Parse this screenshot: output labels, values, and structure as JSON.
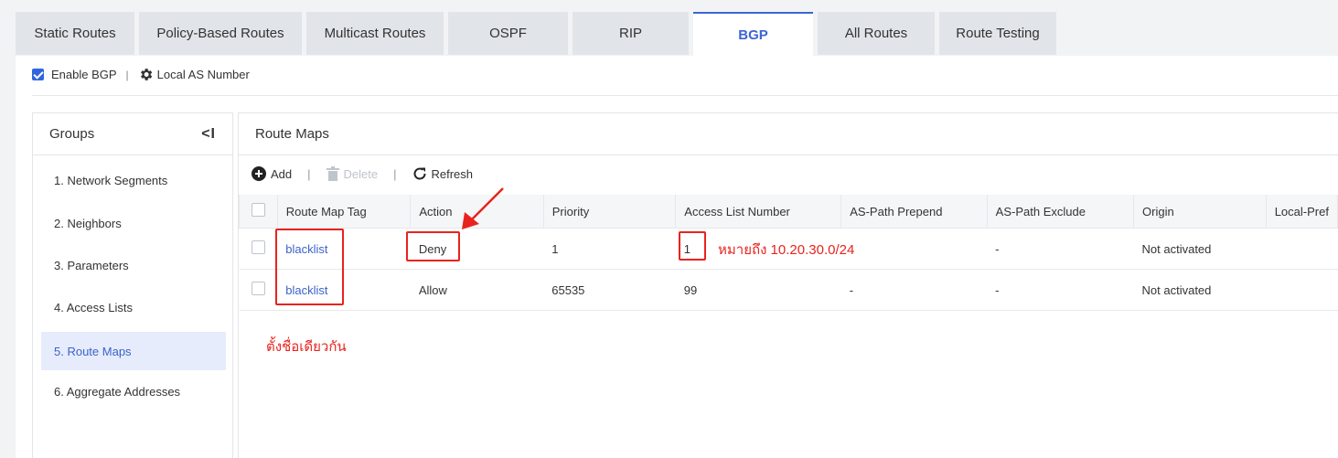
{
  "tabs": [
    "Static Routes",
    "Policy-Based Routes",
    "Multicast Routes",
    "OSPF",
    "RIP",
    "BGP",
    "All Routes",
    "Route Testing"
  ],
  "active_tab": "BGP",
  "toolbar": {
    "enable_label": "Enable BGP",
    "enable_checked": true,
    "as_label": "Local AS Number",
    "separator": "|"
  },
  "groups": {
    "title": "Groups",
    "collapse_icon": "<I",
    "items": [
      "1. Network Segments",
      "2. Neighbors",
      "3. Parameters",
      "4. Access Lists",
      "5. Route Maps",
      "6. Aggregate Addresses"
    ],
    "active_index": 4
  },
  "main": {
    "title": "Route Maps",
    "actions": {
      "add": "Add",
      "delete": "Delete",
      "refresh": "Refresh",
      "separator": "|"
    },
    "columns": [
      "Route Map Tag",
      "Action",
      "Priority",
      "Access List Number",
      "AS-Path Prepend",
      "AS-Path Exclude",
      "Origin",
      "Local-Pref"
    ],
    "rows": [
      {
        "tag": "blacklist",
        "action": "Deny",
        "priority": "1",
        "acl": "1",
        "prepend": "",
        "exclude": "-",
        "origin": "Not activated"
      },
      {
        "tag": "blacklist",
        "action": "Allow",
        "priority": "65535",
        "acl": "99",
        "prepend": "-",
        "exclude": "-",
        "origin": "Not activated"
      }
    ]
  },
  "annotations": {
    "acl_note": "หมายถึง 10.20.30.0/24",
    "tag_note": "ตั้งชื่อเดียวกัน",
    "color": "#e8231e"
  }
}
